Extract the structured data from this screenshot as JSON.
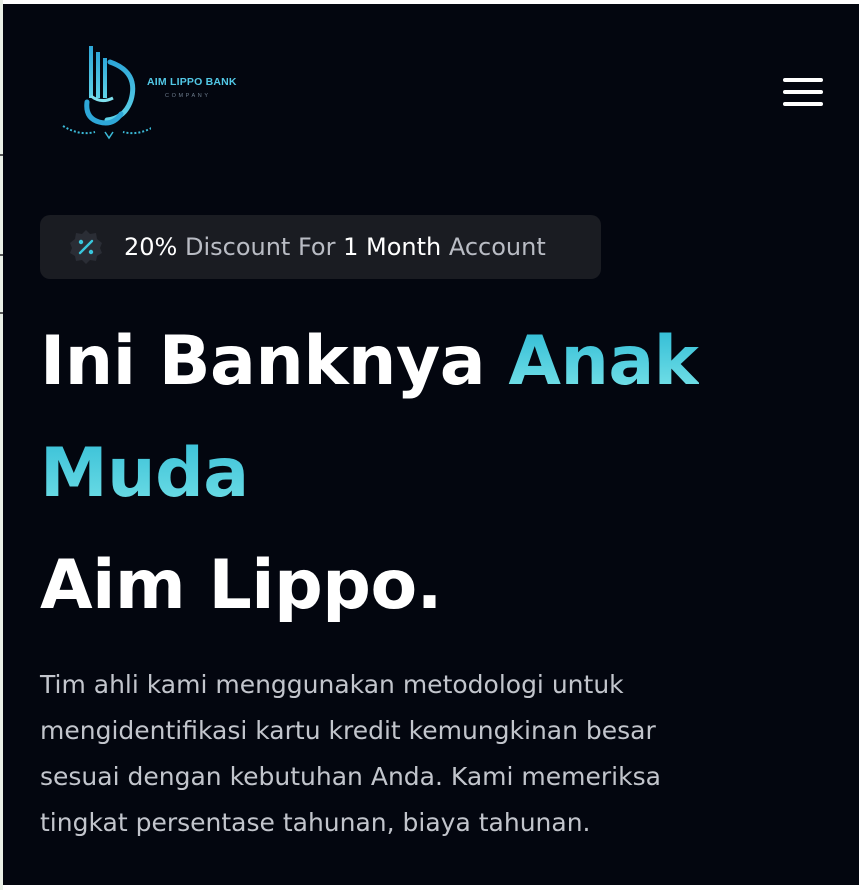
{
  "header": {
    "logo": {
      "name": "AIM LIPPO BANK",
      "tagline": "COMPANY"
    },
    "menu_icon": "hamburger-menu-icon"
  },
  "promo_badge": {
    "icon": "percent-icon",
    "parts": [
      "20%",
      " Discount For ",
      "1 Month",
      " Account"
    ]
  },
  "hero": {
    "title_part1": "Ini Banknya ",
    "title_accent_1": "Anak",
    "title_accent_2": "Muda",
    "title_line3": "Aim Lippo.",
    "description": "Tim ahli kami menggunakan metodologi untuk mengidentifikasi kartu kredit kemungkinan besar sesuai dengan kebutuhan Anda. Kami memeriksa tingkat persentase tahunan, biaya tahunan."
  },
  "colors": {
    "background": "#03060f",
    "accent": "#2bb9d4",
    "badge_bg": "#1a1c22"
  }
}
